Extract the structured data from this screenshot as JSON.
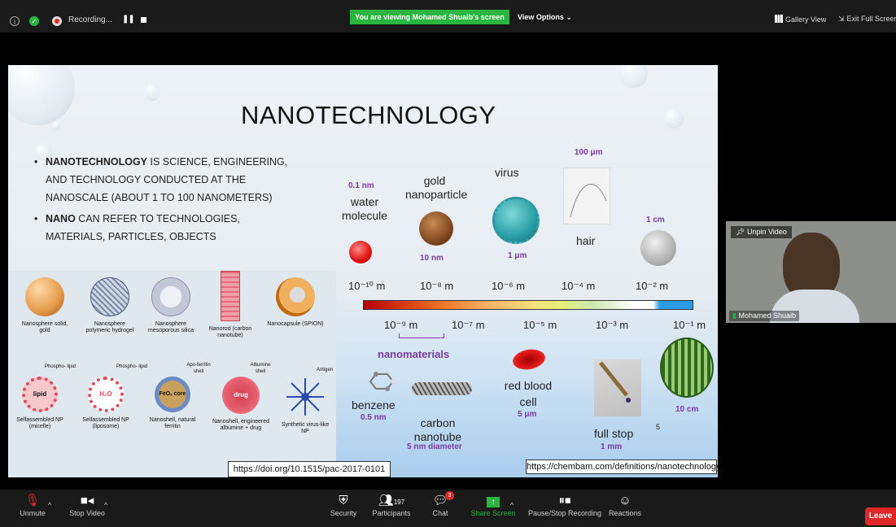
{
  "topbar": {
    "recording_label": "Recording...",
    "share_banner": "You are viewing Mohamed Shuaib's screen",
    "view_options": "View Options ⌄",
    "gallery_view": "Gallery View",
    "exit_fullscreen": "Exit Full Screen"
  },
  "slide": {
    "title": "NANOTECHNOLOGY",
    "bullet1_strong": "NANOTECHNOLOGY",
    "bullet1_rest": " IS SCIENCE, ENGINEERING,",
    "bullet1_line2": "AND TECHNOLOGY CONDUCTED AT THE",
    "bullet1_line3": "NANOSCALE (ABOUT 1 TO 100 NANOMETERS)",
    "bullet2_strong": "NANO",
    "bullet2_rest": " CAN REFER TO TECHNOLOGIES,",
    "bullet2_line2": "MATERIALS, PARTICLES, OBJECTS",
    "water_size": "0.1 nm",
    "water_label": "water molecule",
    "gold_label": "gold nanoparticle",
    "gold_size": "10 nm",
    "virus_label": "virus",
    "virus_size": "1 μm",
    "hair_size": "100 μm",
    "hair_label": "hair",
    "coin_size": "1 cm",
    "scale_top": [
      "10⁻¹⁰ m",
      "10⁻⁸ m",
      "10⁻⁶ m",
      "10⁻⁴ m",
      "10⁻² m"
    ],
    "scale_bottom": [
      "10⁻⁹ m",
      "10⁻⁷ m",
      "10⁻⁵ m",
      "10⁻³ m",
      "10⁻¹ m"
    ],
    "nanomaterials": "nanomaterials",
    "benzene_label": "benzene",
    "benzene_size": "0.5 nm",
    "cnt_label": "carbon nanotube",
    "cnt_size": "5 nm diameter",
    "rbc_label": "red blood cell",
    "rbc_size": "5 μm",
    "fullstop_label": "full stop",
    "fullstop_size": "1 mm",
    "melon_size": "10 cm",
    "slide_number": "5",
    "doi": "https://doi.org/10.1515/pac-2017-0101",
    "chembam": "https://chembam.com/definitions/nanotechnology/"
  },
  "nano_row1": [
    {
      "label": "Nanosphere solid, gold"
    },
    {
      "label": "Nanosphere polymeric hydrogel"
    },
    {
      "label": "Nanosphere mesoporous silica"
    },
    {
      "label": "Nanorod (carbon nanotube)"
    },
    {
      "label": "Nanocapsule (SPION)"
    }
  ],
  "nano_row2": [
    {
      "label": "Selfassembled NP (micelle)",
      "inner": "lipid",
      "tag": "Phospho- lipid"
    },
    {
      "label": "Selfassembled NP (liposome)",
      "inner": "H₂O",
      "tag": "Phospho- lipid"
    },
    {
      "label": "Nanoshell, natural ferritin",
      "inner": "FeOₓ core",
      "tag": "Apo-ferritin shell"
    },
    {
      "label": "Nanoshell, engineered albumine + drug",
      "inner": "drug",
      "tag": "Albumine shell"
    },
    {
      "label": "Synthetic virus-like NP",
      "inner": "",
      "tag": "Antigen"
    }
  ],
  "video": {
    "unpin": "Unpin Video",
    "name": "Mohamed Shuaib"
  },
  "toolbar": {
    "unmute": "Unmute",
    "stop_video": "Stop Video",
    "security": "Security",
    "participants": "Participants",
    "participants_count": "197",
    "chat": "Chat",
    "chat_badge": "3",
    "share_screen": "Share Screen",
    "pause_recording": "Pause/Stop Recording",
    "reactions": "Reactions",
    "leave": "Leave"
  },
  "colors": {
    "banner_green": "#2ab540",
    "leave_red": "#e02828",
    "accent_purple": "#7a3aa0"
  }
}
